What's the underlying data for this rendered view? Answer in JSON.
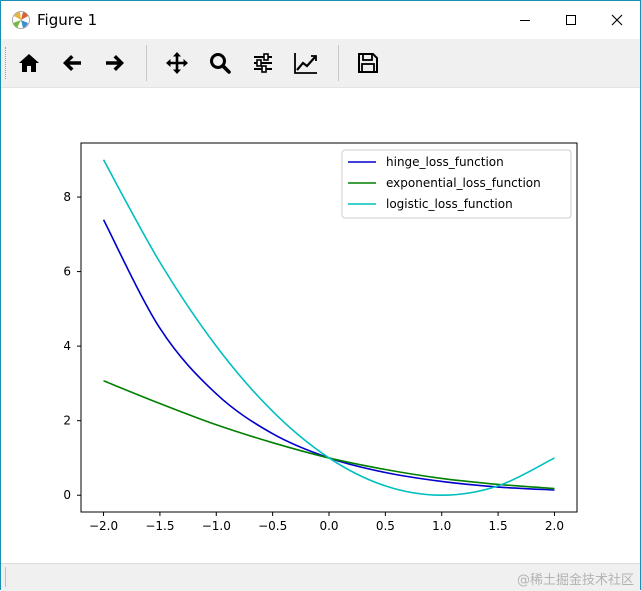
{
  "window": {
    "title": "Figure 1"
  },
  "toolbar": {
    "buttons": [
      {
        "name": "home-button",
        "icon": "home-icon"
      },
      {
        "name": "back-button",
        "icon": "arrow-left-icon"
      },
      {
        "name": "forward-button",
        "icon": "arrow-right-icon"
      },
      {
        "name": "pan-button",
        "icon": "move-icon"
      },
      {
        "name": "zoom-button",
        "icon": "magnifier-icon"
      },
      {
        "name": "configure-subplots-button",
        "icon": "sliders-icon"
      },
      {
        "name": "edit-axis-button",
        "icon": "line-chart-icon"
      },
      {
        "name": "save-button",
        "icon": "floppy-disk-icon"
      }
    ]
  },
  "statusbar": {
    "watermark": "@稀土掘金技术社区"
  },
  "chart_data": {
    "type": "line",
    "title": "",
    "xlabel": "",
    "ylabel": "",
    "xlim": [
      -2.2,
      2.2
    ],
    "ylim": [
      -0.45,
      9.45
    ],
    "xticks": [
      -2.0,
      -1.5,
      -1.0,
      -0.5,
      0.0,
      0.5,
      1.0,
      1.5,
      2.0
    ],
    "xtick_labels": [
      "−2.0",
      "−1.5",
      "−1.0",
      "−0.5",
      "0.0",
      "0.5",
      "1.0",
      "1.5",
      "2.0"
    ],
    "yticks": [
      0,
      2,
      4,
      6,
      8
    ],
    "ytick_labels": [
      "0",
      "2",
      "4",
      "6",
      "8"
    ],
    "grid": false,
    "legend_position": "top-right",
    "x": [
      -2.0,
      -1.5,
      -1.0,
      -0.5,
      0.0,
      0.5,
      1.0,
      1.5,
      2.0
    ],
    "series": [
      {
        "name": "hinge_loss_function",
        "color": "#0000cc",
        "values": [
          7.39,
          4.48,
          2.72,
          1.65,
          1.0,
          0.61,
          0.37,
          0.22,
          0.14
        ]
      },
      {
        "name": "exponential_loss_function",
        "color": "#008000",
        "values": [
          3.07,
          2.46,
          1.89,
          1.41,
          1.0,
          0.69,
          0.45,
          0.29,
          0.18
        ]
      },
      {
        "name": "logistic_loss_function",
        "color": "#00bfbf",
        "values": [
          9.0,
          6.25,
          4.0,
          2.25,
          1.0,
          0.25,
          0.0,
          0.25,
          1.0
        ]
      }
    ]
  }
}
